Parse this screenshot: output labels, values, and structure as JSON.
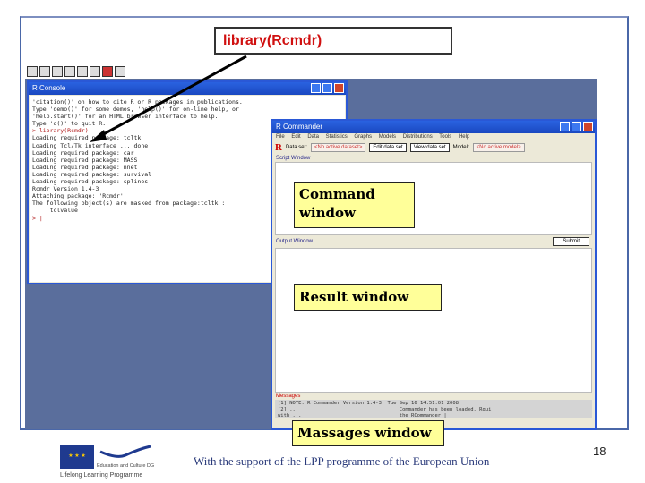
{
  "slide": {
    "callout_top": "library(Rcmdr)",
    "command_note": [
      "Command",
      "window"
    ],
    "result_note": "Result window",
    "messages_note": "Massages window",
    "footer": "With the support of the LPP programme of the European Union",
    "page_number": "18",
    "logo_text": "Education and Culture DG",
    "programme": "Lifelong Learning Programme"
  },
  "console": {
    "title": "R Console",
    "lines": [
      "'citation()' on how to cite R or R packages in publications.",
      "",
      "Type 'demo()' for some demos, 'help()' for on-line help, or",
      "'help.start()' for an HTML browser interface to help.",
      "Type 'q()' to quit R.",
      "",
      "> library(Rcmdr)",
      "Loading required package: tcltk",
      "Loading Tcl/Tk interface ... done",
      "Loading required package: car",
      "Loading required package: MASS",
      "Loading required package: nnet",
      "Loading required package: survival",
      "Loading required package: splines",
      "",
      "Rcmdr Version 1.4-3",
      "",
      "",
      "Attaching package: 'Rcmdr'",
      "",
      "The following object(s) are masked from package:tcltk :",
      "",
      "     tclvalue",
      "",
      "> |"
    ]
  },
  "rcmdr": {
    "title": "R Commander",
    "menu": "File Edit Data Statistics Graphs Models Distributions Tools Help",
    "dataset_label": "Data set:",
    "dataset_value": "<No active dataset>",
    "edit_btn": "Edit data set",
    "view_btn": "View data set",
    "model_label": "Model:",
    "model_value": "<No active model>",
    "script_label": "Script Window",
    "output_label": "Output Window",
    "submit": "Submit",
    "messages_label": "Messages",
    "messages": [
      "[1] NOTE: R Commander Version 1.4-3: Tue Sep 16 14:51:01 2008",
      "[2] ...                                  Commander has been loaded. Rgui",
      "with ...                                 the RCommander |"
    ]
  },
  "colors": {
    "frame": "#4a67a8",
    "note_bg": "#ffff99",
    "callout_text": "#d01010"
  }
}
